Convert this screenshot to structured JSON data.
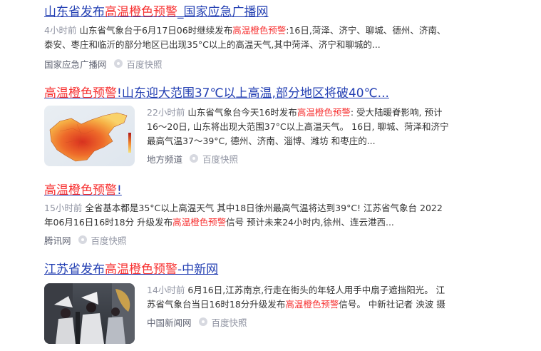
{
  "results": [
    {
      "title_pre": "山东省发布",
      "title_hl": "高温橙色预警",
      "title_post": "_国家应急广播网",
      "time": "4小时前",
      "abstract_pre": "山东省气象台于6月17日06时继续发布",
      "abstract_hl": "高温橙色预警",
      "abstract_post": ":16日,菏泽、济宁、聊城、德州、济南、泰安、枣庄和临沂的部分地区已出现35°C以上的高温天气,其中菏泽、济宁和聊城的...",
      "source": "国家应急广播网",
      "snapshot": "百度快照"
    },
    {
      "title_pre": "",
      "title_hl": "高温橙色预警",
      "title_post": "!山东迎大范围37℃以上高温,部分地区将破40℃...",
      "time": "22小时前",
      "abstract_pre": "山东省气象台今天16时发布",
      "abstract_hl": "高温橙色预警",
      "abstract_post": ": 受大陆暖脊影响, 预计16～20日, 山东将出现大范围37°C以上高温天气。 16日, 聊城、菏泽和济宁最高气温37～39°C, 德州、济南、淄博、潍坊 和枣庄的...",
      "source": "地方频道",
      "snapshot": "百度快照"
    },
    {
      "title_pre": "",
      "title_hl": "高温橙色预警",
      "title_post": "!",
      "time": "15小时前",
      "abstract_pre": "全省基本都是35°C以上高温天气 其中18日徐州最高气温将达到39°C! 江苏省气象台 2022年06月16日16时18分 升级发布",
      "abstract_hl": "高温橙色预警",
      "abstract_post": "信号 预计未来24小时内,徐州、连云港西...",
      "source": "腾讯网",
      "snapshot": "百度快照"
    },
    {
      "title_pre": "江苏省发布",
      "title_hl": "高温橙色预警",
      "title_post": "-中新网",
      "time": "14小时前",
      "abstract_pre": "6月16日,江苏南京,行走在街头的年轻人用手中扇子遮挡阳光。 江苏省气象台当日16时18分升级发布",
      "abstract_hl": "高温橙色预警",
      "abstract_post": "信号。 中新社记者 泱波 摄",
      "source": "中国新闻网",
      "snapshot": "百度快照"
    }
  ],
  "colors": {
    "link": "#2440b3",
    "highlight": "#f73131",
    "meta": "#9195a3"
  }
}
